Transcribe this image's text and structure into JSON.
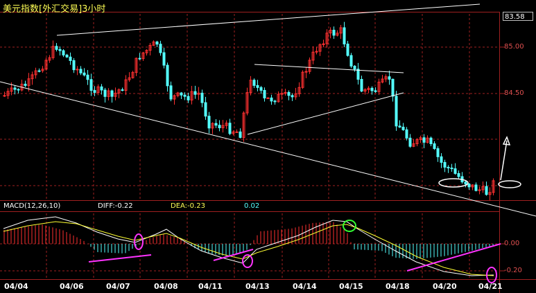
{
  "window": {
    "title": "美元指数[外汇交易]3小时"
  },
  "price_axis": {
    "current_price": "83.58",
    "ticks": [
      "85.00",
      "84.50"
    ]
  },
  "indicator": {
    "name": "MACD(12,26,10)",
    "diff_label": "DIFF:-0.22",
    "dea_label": "DEA:-0.23",
    "macd_value": "0.02",
    "axis_ticks": [
      "0.00",
      "-0.20"
    ]
  },
  "x_axis": {
    "labels": [
      "04/04",
      "04/06",
      "04/07",
      "04/08",
      "04/11",
      "04/13",
      "04/14",
      "04/15",
      "04/18",
      "04/20",
      "04/21"
    ]
  },
  "colors": {
    "up": "#ff3030",
    "down": "#54ffff",
    "grid": "#a02020",
    "diff_line": "#ffffff",
    "dea_line": "#ffff33",
    "annotation": "#ffffff",
    "divergence": "#ff33ff",
    "highlight": "#33ff33"
  }
}
